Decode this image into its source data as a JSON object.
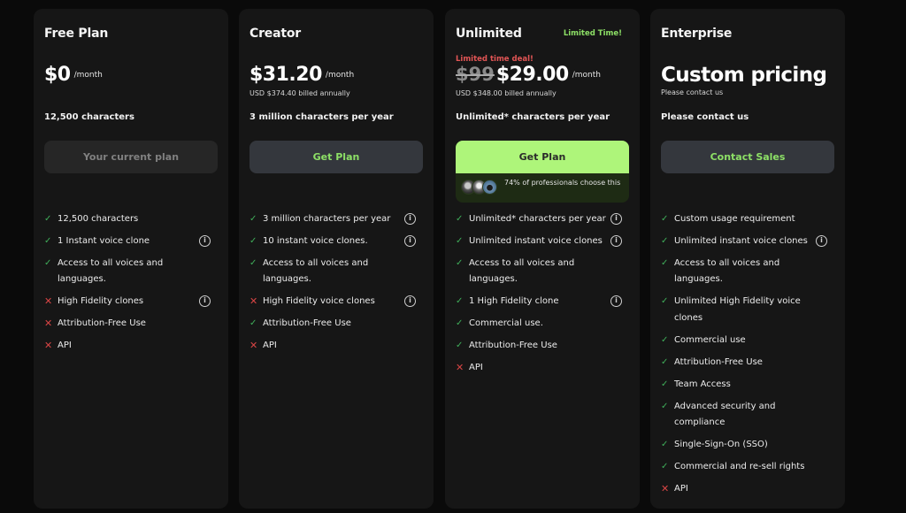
{
  "plans": [
    {
      "name": "Free Plan",
      "price": "$0",
      "per": "/month",
      "summary": "12,500 characters",
      "cta": "Your current plan",
      "features": [
        {
          "text": "12,500 characters",
          "included": true,
          "info": false
        },
        {
          "text": "1 Instant voice clone",
          "included": true,
          "info": true
        },
        {
          "text": "Access to all voices and languages.",
          "included": true,
          "info": false
        },
        {
          "text": "High Fidelity clones",
          "included": false,
          "info": true
        },
        {
          "text": "Attribution-Free Use",
          "included": false,
          "info": false
        },
        {
          "text": "API",
          "included": false,
          "info": false
        }
      ]
    },
    {
      "name": "Creator",
      "price": "$31.20",
      "per": "/month",
      "billing": "USD $374.40 billed annually",
      "summary": "3 million characters per year",
      "cta": "Get Plan",
      "features": [
        {
          "text": "3 million characters per year",
          "included": true,
          "info": true
        },
        {
          "text": "10 instant voice clones.",
          "included": true,
          "info": true
        },
        {
          "text": "Access to all voices and languages.",
          "included": true,
          "info": false
        },
        {
          "text": "High Fidelity voice clones",
          "included": false,
          "info": true
        },
        {
          "text": "Attribution-Free Use",
          "included": true,
          "info": false
        },
        {
          "text": "API",
          "included": false,
          "info": false
        }
      ]
    },
    {
      "name": "Unlimited",
      "tag": "Limited Time!",
      "deal_label": "Limited time deal!",
      "old_price": "$99",
      "price": "$29.00",
      "per": "/month",
      "billing": "USD $348.00 billed annually",
      "summary": "Unlimited* characters per year",
      "cta": "Get Plan",
      "social_proof": "74% of professionals choose this",
      "features": [
        {
          "text": "Unlimited* characters per year",
          "included": true,
          "info": true
        },
        {
          "text": "Unlimited instant voice clones",
          "included": true,
          "info": true
        },
        {
          "text": "Access to all voices and languages.",
          "included": true,
          "info": false
        },
        {
          "text": "1 High Fidelity clone",
          "included": true,
          "info": true
        },
        {
          "text": "Commercial use.",
          "included": true,
          "info": false
        },
        {
          "text": "Attribution-Free Use",
          "included": true,
          "info": false
        },
        {
          "text": "API",
          "included": false,
          "info": false
        }
      ]
    },
    {
      "name": "Enterprise",
      "price": "Custom pricing",
      "billing": "Please contact us",
      "summary": "Please contact us",
      "cta": "Contact Sales",
      "features": [
        {
          "text": "Custom usage requirement",
          "included": true,
          "info": false
        },
        {
          "text": "Unlimited instant voice clones",
          "included": true,
          "info": true
        },
        {
          "text": "Access to all voices and languages.",
          "included": true,
          "info": false
        },
        {
          "text": "Unlimited High Fidelity voice clones",
          "included": true,
          "info": false
        },
        {
          "text": "Commercial use",
          "included": true,
          "info": false
        },
        {
          "text": "Attribution-Free Use",
          "included": true,
          "info": false
        },
        {
          "text": "Team Access",
          "included": true,
          "info": false
        },
        {
          "text": "Advanced security and compliance",
          "included": true,
          "info": false
        },
        {
          "text": "Single-Sign-On (SSO)",
          "included": true,
          "info": false
        },
        {
          "text": "Commercial and re-sell rights",
          "included": true,
          "info": false
        },
        {
          "text": "API",
          "included": false,
          "info": false
        }
      ]
    }
  ],
  "icons": {
    "check": "✓",
    "cross": "✕",
    "info": "i"
  },
  "colors": {
    "accent_green": "#8de066",
    "cta_primary_bg": "#aef57a",
    "deal_red": "#e25555",
    "check_green": "#3fae5a",
    "cross_red": "#d84545"
  }
}
